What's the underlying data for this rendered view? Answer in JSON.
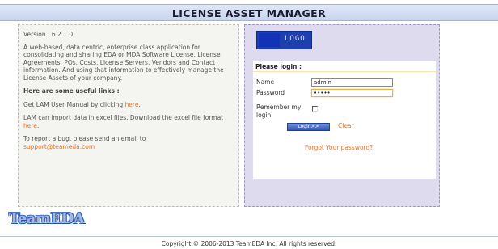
{
  "header": {
    "title": "LICENSE ASSET MANAGER"
  },
  "info": {
    "version": "Version : 6.2.1.0",
    "description": "A web-based, data centric, enterprise class application for consolidating and sharing EDA or MDA Software License, License Agreements, POs, Costs, License Servers, Vendors and Contact information. And using that information to effectively manage the License Assets of your company.",
    "links_heading": "Here are some useful links :",
    "manual_prefix": "Get LAM User Manual by clicking ",
    "manual_link": "here",
    "manual_suffix": ".",
    "import_prefix": "LAM can import data in excel files. Download the excel file format ",
    "import_link": "here",
    "import_suffix": ".",
    "bug_text": "To report a bug, please send an email to",
    "bug_email": "support@teameda.com"
  },
  "login": {
    "logo_text": "LOGO",
    "header": "Please login :",
    "name_label": "Name",
    "name_value": "admin",
    "password_label": "Password",
    "password_value": "•••••",
    "remember_label_1": "Remember my",
    "remember_label_2": "login",
    "login_button": "Login>>",
    "clear_link": "Clear",
    "forgot_link": "Forgot Your password?"
  },
  "brand": {
    "logo_text": "TeamEDA"
  },
  "footer": {
    "copyright": "Copyright © 2006-2013 TeamEDA Inc, All rights reserved."
  },
  "colors": {
    "accent_link": "#e8742a",
    "title_bar": "#c6d4ee",
    "login_panel_bg": "#dedbee",
    "button_blue": "#2f55b3"
  }
}
